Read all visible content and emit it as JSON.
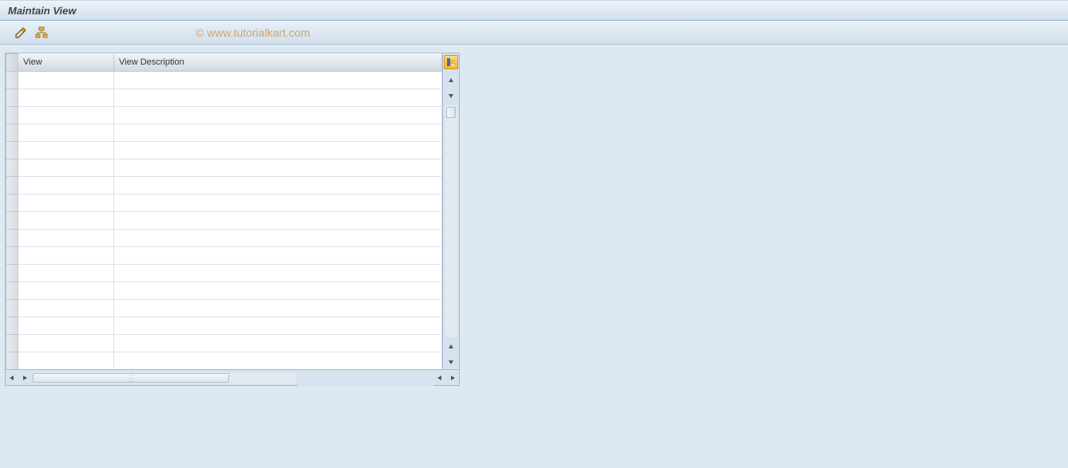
{
  "title": "Maintain View",
  "watermark": "© www.tutorialkart.com",
  "toolbar": {
    "icons": {
      "edit": "pencil-icon",
      "structure": "structure-icon"
    }
  },
  "table": {
    "columns": {
      "view": "View",
      "description": "View Description"
    },
    "rows": [
      {
        "view": "",
        "description": ""
      },
      {
        "view": "",
        "description": ""
      },
      {
        "view": "",
        "description": ""
      },
      {
        "view": "",
        "description": ""
      },
      {
        "view": "",
        "description": ""
      },
      {
        "view": "",
        "description": ""
      },
      {
        "view": "",
        "description": ""
      },
      {
        "view": "",
        "description": ""
      },
      {
        "view": "",
        "description": ""
      },
      {
        "view": "",
        "description": ""
      },
      {
        "view": "",
        "description": ""
      },
      {
        "view": "",
        "description": ""
      },
      {
        "view": "",
        "description": ""
      },
      {
        "view": "",
        "description": ""
      },
      {
        "view": "",
        "description": ""
      },
      {
        "view": "",
        "description": ""
      },
      {
        "view": "",
        "description": ""
      }
    ]
  }
}
